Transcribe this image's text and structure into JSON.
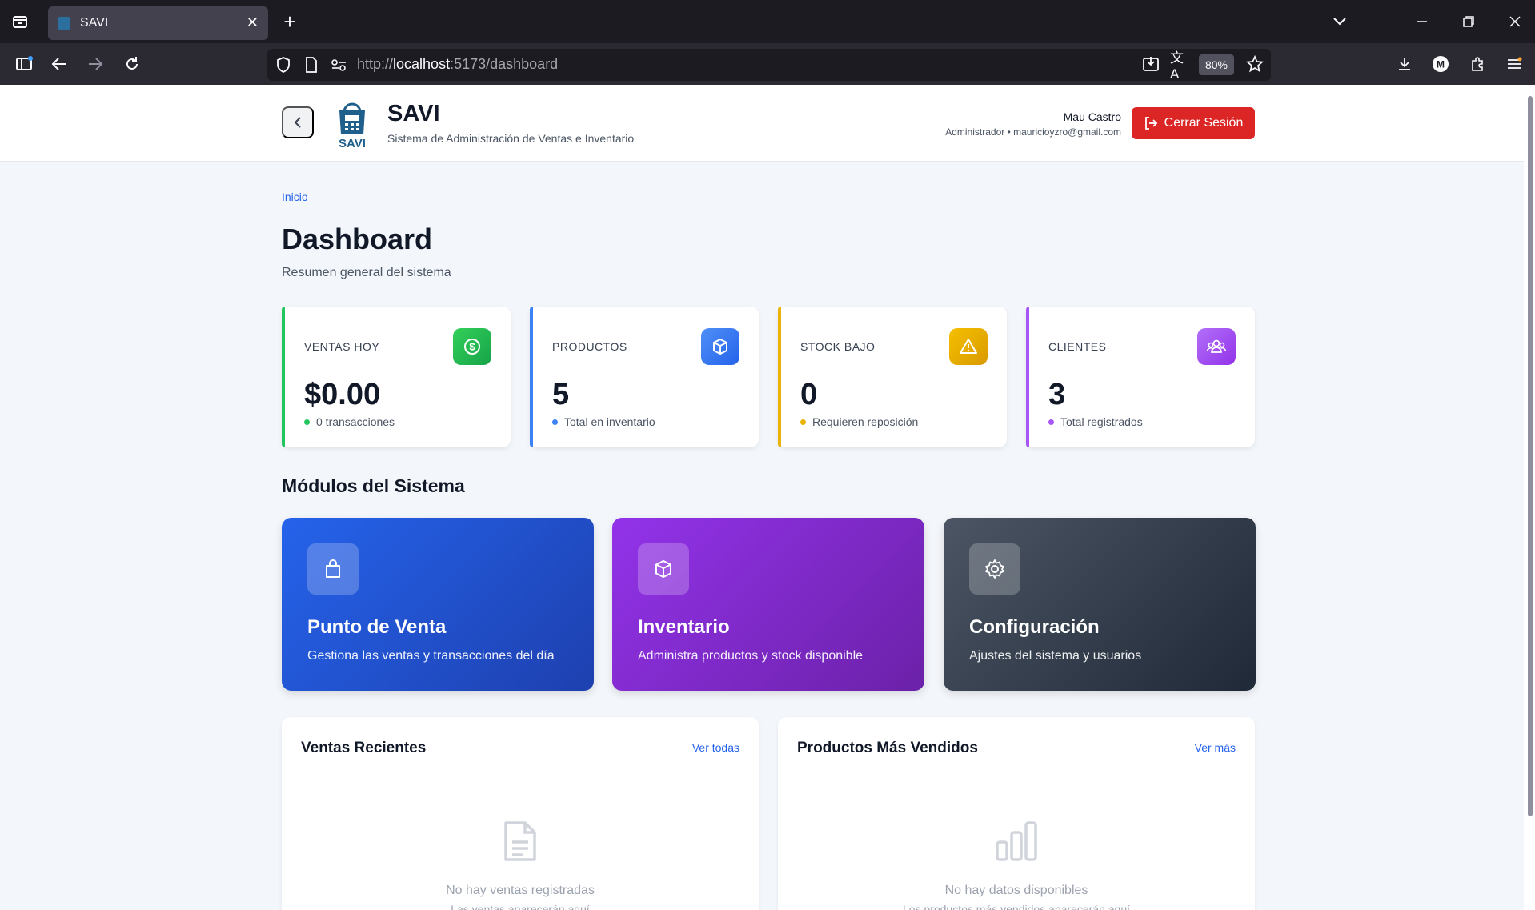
{
  "browser": {
    "tab_title": "SAVI",
    "url_prefix": "http://",
    "url_host": "localhost",
    "url_path": ":5173/dashboard",
    "zoom": "80%"
  },
  "header": {
    "app_name": "SAVI",
    "app_subtitle": "Sistema de Administración de Ventas e Inventario",
    "logo_text": "SAVI",
    "user_name": "Mau Castro",
    "user_role": "Administrador • mauricioyzro@gmail.com",
    "logout_label": "Cerrar Sesión"
  },
  "main": {
    "breadcrumb": "Inicio",
    "title": "Dashboard",
    "subtitle": "Resumen general del sistema",
    "stats": [
      {
        "label": "VENTAS HOY",
        "value": "$0.00",
        "note": "0 transacciones",
        "color": "#22c55e",
        "icon": "dollar-icon"
      },
      {
        "label": "PRODUCTOS",
        "value": "5",
        "note": "Total en inventario",
        "color": "#3b82f6",
        "icon": "box-icon"
      },
      {
        "label": "STOCK BAJO",
        "value": "0",
        "note": "Requieren reposición",
        "color": "#eab308",
        "icon": "warning-icon"
      },
      {
        "label": "CLIENTES",
        "value": "3",
        "note": "Total registrados",
        "color": "#a855f7",
        "icon": "users-icon"
      }
    ],
    "modules_title": "Módulos del Sistema",
    "modules": [
      {
        "title": "Punto de Venta",
        "desc": "Gestiona las ventas y transacciones del día",
        "icon": "shopping-bag-icon"
      },
      {
        "title": "Inventario",
        "desc": "Administra productos y stock disponible",
        "icon": "box-icon"
      },
      {
        "title": "Configuración",
        "desc": "Ajustes del sistema y usuarios",
        "icon": "gear-icon"
      }
    ],
    "panels": [
      {
        "title": "Ventas Recientes",
        "link": "Ver todas",
        "empty": "No hay ventas registradas",
        "empty_sub": "Las ventas aparecerán aquí",
        "icon": "document-icon"
      },
      {
        "title": "Productos Más Vendidos",
        "link": "Ver más",
        "empty": "No hay datos disponibles",
        "empty_sub": "Los productos más vendidos aparecerán aquí",
        "icon": "bar-chart-icon"
      }
    ]
  }
}
